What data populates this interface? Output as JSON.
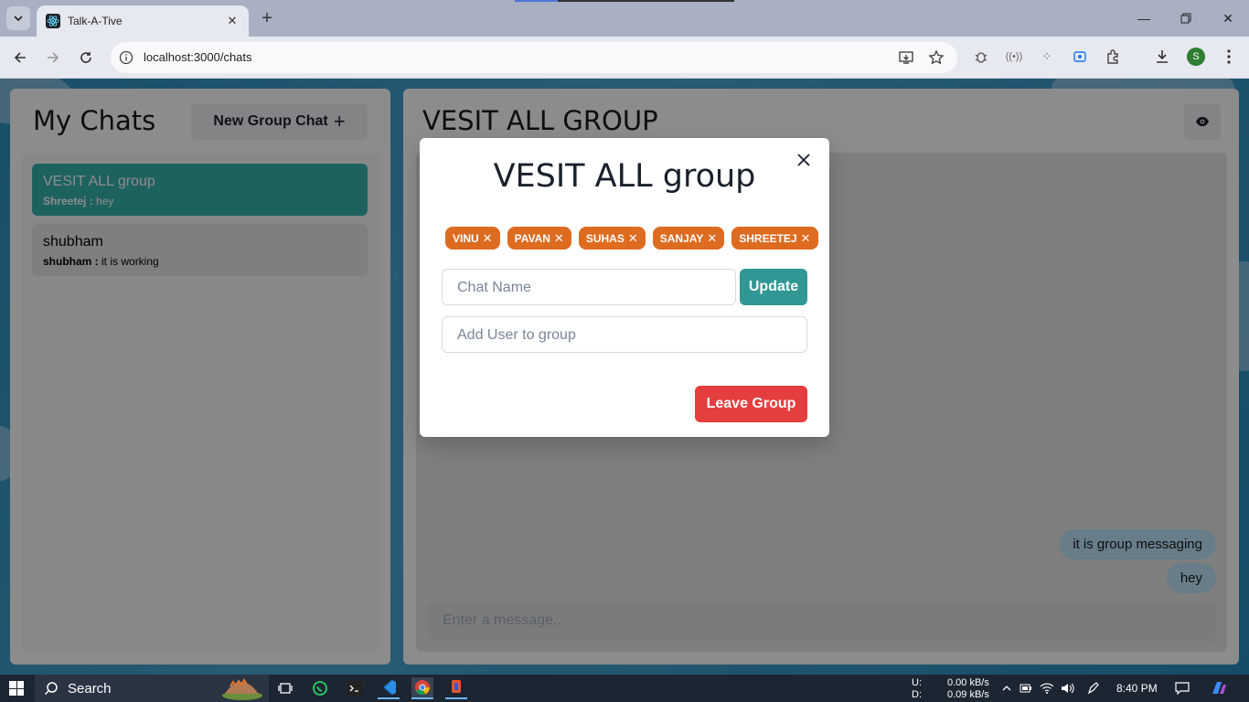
{
  "browser": {
    "tab_title": "Talk-A-Tive",
    "url": "localhost:3000/chats",
    "profile_initial": "S"
  },
  "left": {
    "title": "My Chats",
    "new_group_label": "New Group Chat",
    "chats": [
      {
        "name": "VESIT ALL group",
        "sender": "Shreetej :",
        "message": "hey",
        "active": true
      },
      {
        "name": "shubham",
        "sender": "shubham :",
        "message": "it is working",
        "active": false
      }
    ]
  },
  "right": {
    "title": "VESIT ALL GROUP",
    "messages": [
      "it is group messaging",
      "hey"
    ],
    "message_placeholder": "Enter a message.."
  },
  "modal": {
    "title": "VESIT ALL group",
    "members": [
      "VINU",
      "PAVAN",
      "SUHAS",
      "SANJAY",
      "SHREETEJ"
    ],
    "chat_name_placeholder": "Chat Name",
    "update_label": "Update",
    "add_user_placeholder": "Add User to group",
    "leave_label": "Leave Group"
  },
  "taskbar": {
    "search_label": "Search",
    "upload_label": "U:",
    "download_label": "D:",
    "upload_speed": "0.00 kB/s",
    "download_speed": "0.09 kB/s",
    "time": "8:40 PM"
  }
}
